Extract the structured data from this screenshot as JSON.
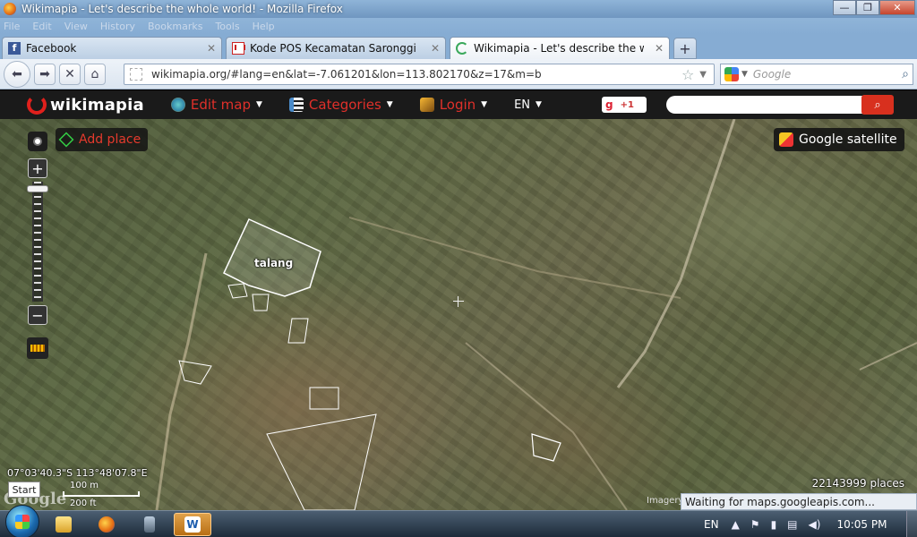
{
  "window": {
    "title": "Wikimapia - Let's describe the whole world! - Mozilla Firefox",
    "controls": [
      "—",
      "❐",
      "✕"
    ]
  },
  "menu": [
    "File",
    "Edit",
    "View",
    "History",
    "Bookmarks",
    "Tools",
    "Help"
  ],
  "tabs": [
    {
      "label": "Facebook",
      "icon": "facebook-icon"
    },
    {
      "label": "Kode POS Kecamatan Saronggi Kab. Su...",
      "icon": "gmail-icon"
    },
    {
      "label": "Wikimapia - Let's describe the whole w...",
      "icon": "wikimapia-icon"
    }
  ],
  "nav": {
    "url": "wikimapia.org/#lang=en&lat=-7.061201&lon=113.802170&z=17&m=b",
    "search_placeholder": "Google"
  },
  "wikimapia": {
    "logo": "wikimapia",
    "menu": [
      {
        "label": "Edit map",
        "icon": "globe-edit-icon"
      },
      {
        "label": "Categories",
        "icon": "categories-icon"
      },
      {
        "label": "Login",
        "icon": "login-icon"
      }
    ],
    "lang": "EN",
    "gplus": "+1",
    "search_value": ""
  },
  "map": {
    "add_place": "Add place",
    "layer": "Google satellite",
    "polygon_label": "talang",
    "coords": "07°03'40.3\"S 113°48'07.8\"E",
    "scale_m": "100 m",
    "scale_ft": "200 ft",
    "places_count": "22143999 places",
    "imagery": "Imagery",
    "google_logo": "Google",
    "start_tooltip": "Start"
  },
  "status": "Waiting for maps.googleapis.com...",
  "taskbar": {
    "lang": "EN",
    "time": "10:05 PM"
  }
}
